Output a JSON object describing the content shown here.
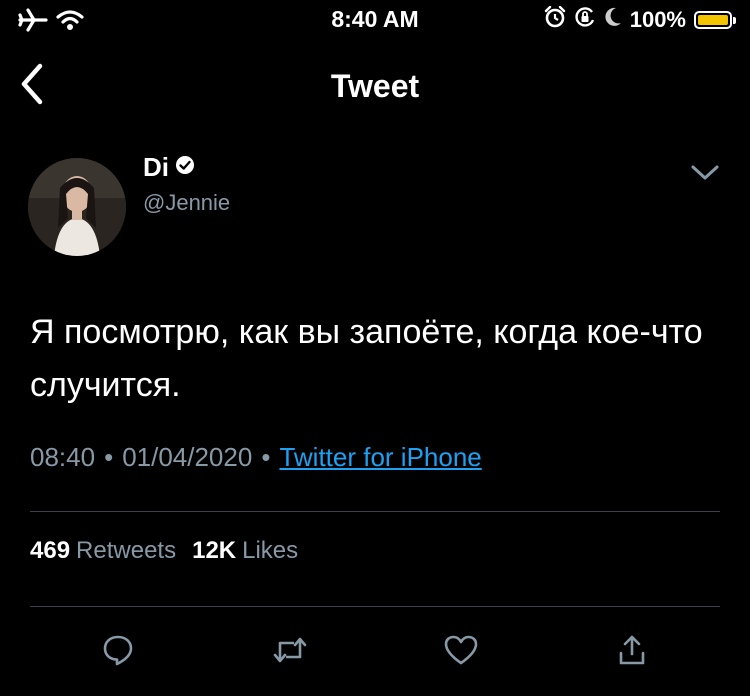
{
  "status_bar": {
    "time": "8:40 AM",
    "battery_percent": "100%",
    "battery_level": 1.0,
    "icons": [
      "airplane-icon",
      "wifi-icon",
      "alarm-icon",
      "orientation-lock-icon",
      "moon-icon",
      "battery-icon"
    ]
  },
  "nav": {
    "title": "Tweet",
    "back_icon": "chevron-left-icon"
  },
  "tweet": {
    "author": {
      "display_name": "Di",
      "handle": "@Jennie",
      "verified": true
    },
    "text": "Я посмотрю, как вы запоёте, когда кое-что случится.",
    "time": "08:40",
    "date": "01/04/2020",
    "separator": "•",
    "source": "Twitter for iPhone",
    "stats": {
      "retweets_count": "469",
      "retweets_label": "Retweets",
      "likes_count": "12K",
      "likes_label": "Likes"
    }
  },
  "actions": [
    "reply-icon",
    "retweet-icon",
    "like-icon",
    "share-icon"
  ],
  "colors": {
    "background": "#000000",
    "text": "#ffffff",
    "secondary_text": "#8899a6",
    "link": "#1da1f2",
    "divider": "#38444d",
    "battery": "#f5c400"
  }
}
